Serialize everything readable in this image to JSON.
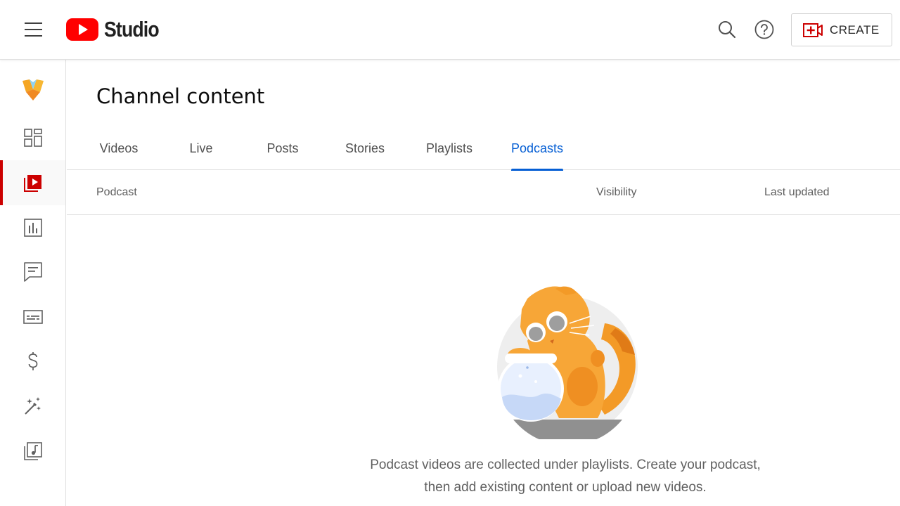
{
  "header": {
    "app_name": "Studio",
    "create_label": "CREATE"
  },
  "page": {
    "title": "Channel content"
  },
  "tabs": [
    {
      "label": "Videos",
      "active": false
    },
    {
      "label": "Live",
      "active": false
    },
    {
      "label": "Posts",
      "active": false
    },
    {
      "label": "Stories",
      "active": false
    },
    {
      "label": "Playlists",
      "active": false
    },
    {
      "label": "Podcasts",
      "active": true
    }
  ],
  "table": {
    "columns": [
      "Podcast",
      "Visibility",
      "Last updated"
    ]
  },
  "empty_state": {
    "line1": "Podcast videos are collected under playlists. Create your podcast,",
    "line2": "then add existing content or upload new videos."
  },
  "sidebar": {
    "items": [
      {
        "icon": "channel-avatar-icon",
        "active": false
      },
      {
        "icon": "dashboard-icon",
        "active": false
      },
      {
        "icon": "content-icon",
        "active": true
      },
      {
        "icon": "analytics-icon",
        "active": false
      },
      {
        "icon": "comments-icon",
        "active": false
      },
      {
        "icon": "subtitles-icon",
        "active": false
      },
      {
        "icon": "earn-icon",
        "active": false
      },
      {
        "icon": "customization-icon",
        "active": false
      },
      {
        "icon": "audio-library-icon",
        "active": false
      }
    ]
  },
  "colors": {
    "accent_blue": "#065fd4",
    "brand_red": "#ff0000",
    "active_red": "#cc0000"
  }
}
